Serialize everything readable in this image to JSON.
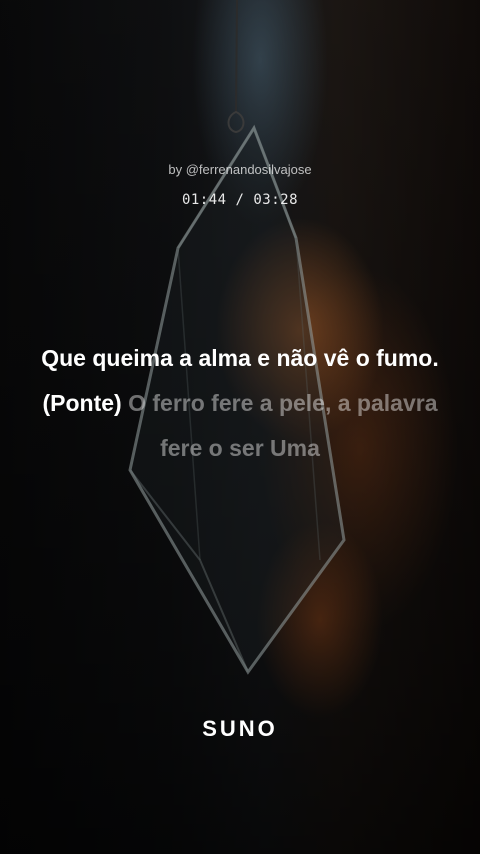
{
  "player": {
    "byline": "by @ferrenandosilvajose",
    "time": "01:44 / 03:28"
  },
  "lyrics": {
    "sung": "Que queima a alma e não vê o fumo. (Ponte)",
    "upcoming": "O ferro fere a pele, a palavra fere o ser Uma"
  },
  "brand": {
    "logo": "SUNO"
  },
  "colors": {
    "background": "#0b0b0c",
    "sung_text": "#ffffff",
    "upcoming_text": "#8a8a8a",
    "glow": "#e0782c"
  }
}
